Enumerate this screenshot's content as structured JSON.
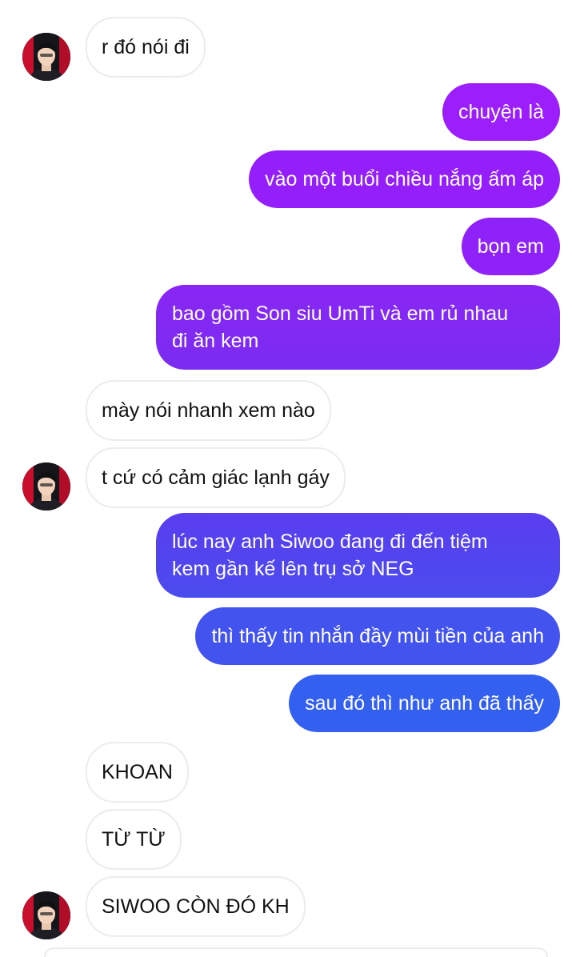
{
  "colors": {
    "received_bg": "#ffffff",
    "received_border": "#ececec",
    "received_text": "#111111",
    "sent_text": "#ffffff",
    "gradient_top": "#9b1ffb",
    "gradient_bottom": "#2f62ee"
  },
  "messages": [
    {
      "side": "received",
      "text": "r đó nói đi",
      "avatar": true
    },
    {
      "side": "sent",
      "text": "chuyện là"
    },
    {
      "side": "sent",
      "text": "vào một buổi chiều nắng ấm áp"
    },
    {
      "side": "sent",
      "text": "bọn em"
    },
    {
      "side": "sent",
      "lines": [
        "bao gồm Son siu UmTi và em rủ nhau",
        "đi ăn kem"
      ]
    },
    {
      "side": "received",
      "text": "mày nói nhanh xem nào"
    },
    {
      "side": "received",
      "text": "t cứ có cảm giác lạnh gáy",
      "avatar": true
    },
    {
      "side": "sent",
      "lines": [
        "lúc nay anh Siwoo đang đi đến tiệm",
        "kem gần kế lên trụ sở NEG"
      ]
    },
    {
      "side": "sent",
      "text": "thì thấy tin nhắn đầy mùi tiền của anh"
    },
    {
      "side": "sent",
      "text": "sau đó thì như anh đã thấy"
    },
    {
      "side": "received",
      "text": "KHOAN"
    },
    {
      "side": "received",
      "text": "TỪ TỪ"
    },
    {
      "side": "received",
      "text": "SIWOO CÒN ĐÓ KH",
      "avatar": true
    }
  ]
}
